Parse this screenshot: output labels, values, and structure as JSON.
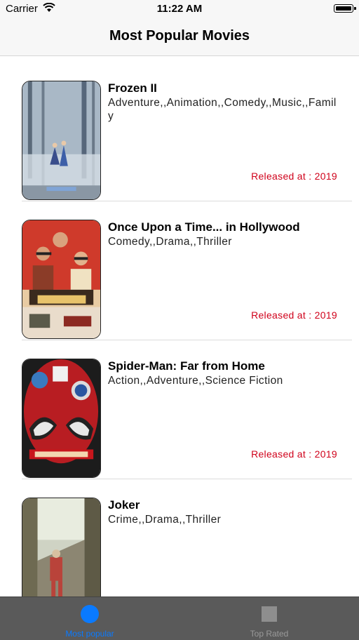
{
  "status_bar": {
    "carrier": "Carrier",
    "time": "11:22 AM",
    "wifi_icon": "wifi-icon",
    "battery_icon": "battery-icon"
  },
  "nav": {
    "title": "Most Popular Movies"
  },
  "movies": [
    {
      "title": "Frozen II",
      "genres": "Adventure,,Animation,,Comedy,,Music,,Family",
      "release": "Released at : 2019",
      "poster_palette": [
        "#5a6e82",
        "#b9c7d2"
      ]
    },
    {
      "title": "Once Upon a Time... in Hollywood",
      "genres": "Comedy,,Drama,,Thriller",
      "release": "Released at : 2019",
      "poster_palette": [
        "#c9302c",
        "#f1e3c8"
      ]
    },
    {
      "title": "Spider-Man: Far from Home",
      "genres": "Action,,Adventure,,Science Fiction",
      "release": "Released at : 2019",
      "poster_palette": [
        "#b31218",
        "#1b1b1b"
      ]
    },
    {
      "title": "Joker",
      "genres": "Crime,,Drama,,Thriller",
      "release": "",
      "poster_palette": [
        "#8c8a6e",
        "#c25a4a"
      ]
    }
  ],
  "tabs": [
    {
      "label": "Most popular",
      "icon": "circle-icon",
      "active": true
    },
    {
      "label": "Top Rated",
      "icon": "square-icon",
      "active": false
    }
  ],
  "colors": {
    "accent": "#0a7aff",
    "release_red": "#d0021b",
    "tabbar_bg": "#5a5a5a"
  }
}
